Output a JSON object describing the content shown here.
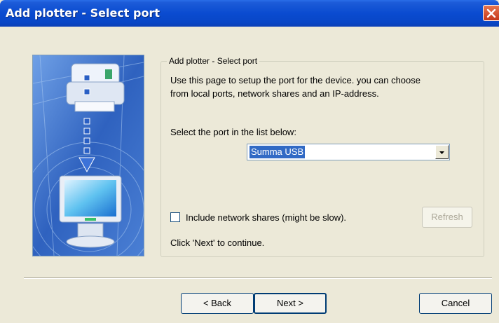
{
  "window": {
    "title": "Add plotter - Select port"
  },
  "group": {
    "legend": "Add plotter - Select port",
    "description_line1": "Use this page to setup the port for the device. you can choose",
    "description_line2": "from local ports, network shares and an IP-address.",
    "port_prompt": "Select the port in the list below:",
    "port_selected": "Summa USB",
    "include_network_shares_label": "Include network shares (might be slow).",
    "include_network_shares_checked": false,
    "refresh_label": "Refresh",
    "continue_hint": "Click 'Next' to continue."
  },
  "buttons": {
    "back": "< Back",
    "next": "Next >",
    "cancel": "Cancel"
  },
  "icons": {
    "close": "close-icon",
    "dropdown": "chevron-down-icon",
    "wizard_art": "plotter-to-computer-illustration"
  },
  "colors": {
    "titlebar": "#0a4bd0",
    "dialog_bg": "#ece9d8",
    "selection": "#316ac5",
    "close_button": "#d9502c"
  }
}
